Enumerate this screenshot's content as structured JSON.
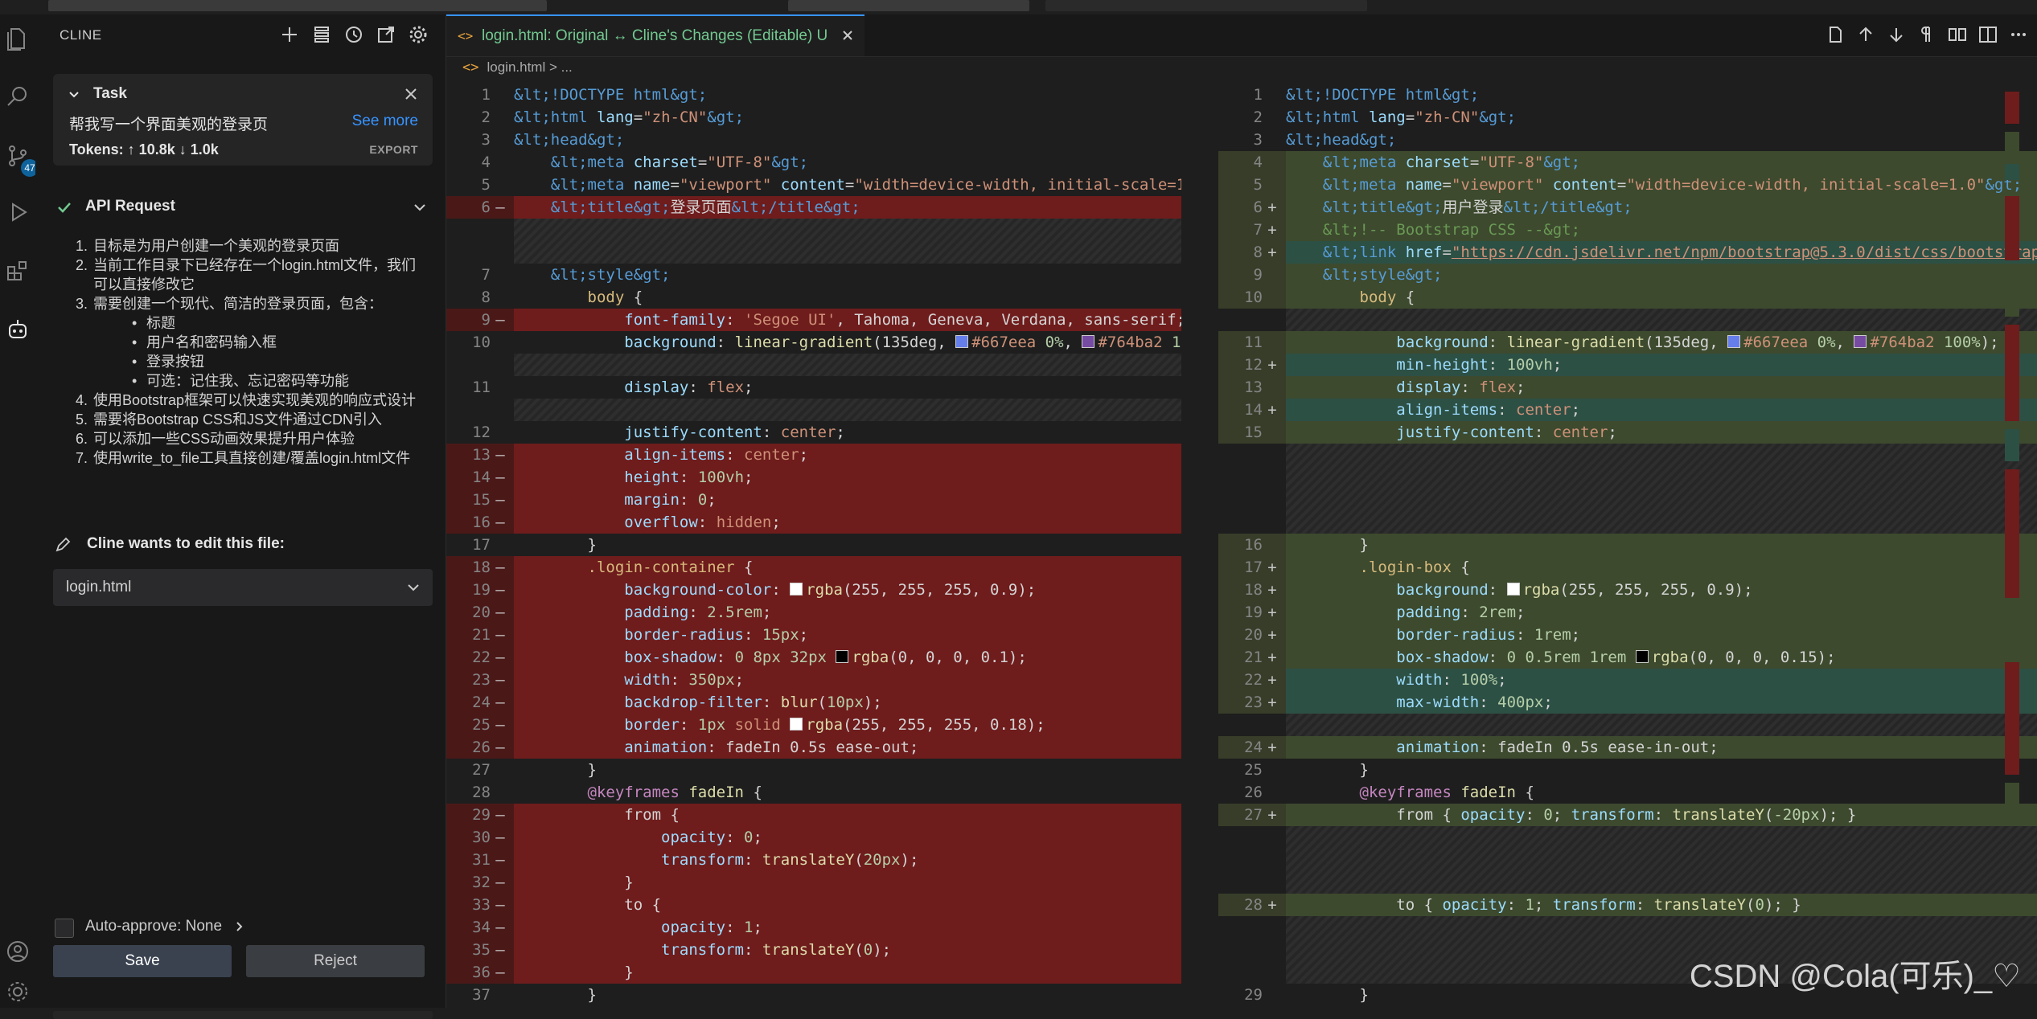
{
  "sidebar": {
    "title": "CLINE",
    "actions": [
      "plus-icon",
      "list-icon",
      "history-icon",
      "open-external-icon",
      "gear-icon"
    ],
    "task": {
      "header": "Task",
      "description": "帮我写一个界面美观的登录页",
      "see_more": "See more",
      "tokens": "Tokens: ↑ 10.8k ↓ 1.0k",
      "export": "EXPORT"
    },
    "api_request": {
      "title": "API Request",
      "items": [
        {
          "n": "1.",
          "text": "目标是为用户创建一个美观的登录页面"
        },
        {
          "n": "2.",
          "text": "当前工作目录下已经存在一个login.html文件，我们可以直接修改它"
        },
        {
          "n": "3.",
          "text": "需要创建一个现代、简洁的登录页面，包含：",
          "sub": [
            "标题",
            "用户名和密码输入框",
            "登录按钮",
            "可选：记住我、忘记密码等功能"
          ]
        },
        {
          "n": "4.",
          "text": "使用Bootstrap框架可以快速实现美观的响应式设计"
        },
        {
          "n": "5.",
          "text": "需要将Bootstrap CSS和JS文件通过CDN引入"
        },
        {
          "n": "6.",
          "text": "可以添加一些CSS动画效果提升用户体验"
        },
        {
          "n": "7.",
          "text": "使用write_to_file工具直接创建/覆盖login.html文件"
        }
      ]
    },
    "edit_label": "Cline wants to edit this file:",
    "file": "login.html",
    "auto_approve": "Auto-approve: None",
    "save": "Save",
    "reject": "Reject"
  },
  "activity": {
    "badge": "47"
  },
  "editor": {
    "tab_label": "login.html: Original ↔ Cline's Changes (Editable)  U",
    "tab_icon": "<>",
    "breadcrumb": "login.html  >  ...",
    "breadcrumb_icon": "<>"
  },
  "watermark": "CSDN @Cola(可乐)_♡",
  "colors": {
    "accent": "#3794ff",
    "deleted": "#6f1c1c",
    "inserted": "#3d4a2e",
    "modified": "#2d5045"
  }
}
